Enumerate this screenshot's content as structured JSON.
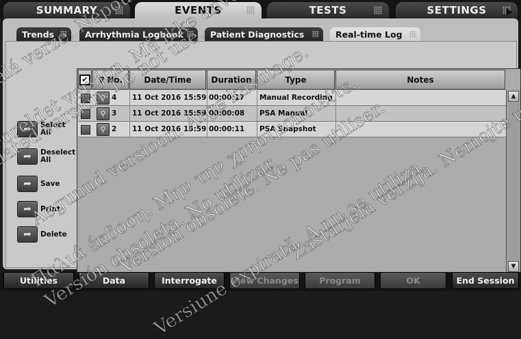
{
  "top_tabs": [
    {
      "label": "SUMMARY",
      "active": false
    },
    {
      "label": "EVENTS",
      "active": true
    },
    {
      "label": "TESTS",
      "active": false
    },
    {
      "label": "SETTINGS",
      "active": false
    }
  ],
  "sub_tabs": [
    {
      "label": "Trends",
      "active": false
    },
    {
      "label": "Arrhythmia Logbook",
      "active": false
    },
    {
      "label": "Patient Diagnostics",
      "active": false
    },
    {
      "label": "Real-time Log",
      "active": true
    }
  ],
  "side_actions": [
    {
      "label": "Select All",
      "icon": "select-arrow-icon"
    },
    {
      "label": "Deselect All",
      "icon": "deselect-arrow-icon"
    },
    {
      "label": "Save",
      "icon": "save-arrow-icon"
    },
    {
      "label": "Print",
      "icon": "print-arrow-icon"
    },
    {
      "label": "Delete",
      "icon": "delete-arrow-icon"
    }
  ],
  "table": {
    "sort_glyph": "∇",
    "columns": [
      "No.",
      "Date/Time",
      "Duration",
      "Type",
      "Notes"
    ],
    "rows": [
      {
        "no": "4",
        "datetime": "11 Oct 2016 15:59",
        "duration": "00:00:17",
        "type": "Manual Recording",
        "notes": ""
      },
      {
        "no": "3",
        "datetime": "11 Oct 2016 15:59",
        "duration": "00:00:08",
        "type": "PSA Manual",
        "notes": ""
      },
      {
        "no": "2",
        "datetime": "11 Oct 2016 15:59",
        "duration": "00:00:11",
        "type": "PSA Snapshot",
        "notes": ""
      }
    ]
  },
  "bottom_buttons": [
    {
      "label": "Utilities",
      "enabled": true
    },
    {
      "label": "Data",
      "enabled": true
    },
    {
      "label": "Interrogate",
      "enabled": true
    },
    {
      "label": "View Changes",
      "enabled": false
    },
    {
      "label": "Program",
      "enabled": false
    },
    {
      "label": "OK",
      "enabled": false
    },
    {
      "label": "End Session",
      "enabled": true
    }
  ],
  "watermark_lines": [
    "Outdated version. Do not use.",
    "Version obsolète. Ne pas utiliser.",
    "Versión obsoleta. No utilizar.",
    "Zastaralá verze. Nepoužívat.",
    "Aegunud versioon. Ärge kasutage.",
    "Παλιά έκδοση. Μην την χρησιμοποιείτε.",
    "Zastarjela verzija. Nemojte upotrebljavati.",
    "Foreldet versjon. Må ikke anvendes.",
    "Versiune expirată. A nu se utiliza."
  ],
  "colors": {
    "frame": "#141414",
    "panel": "#bdbdbd",
    "active_tab": "#cfcfcf"
  }
}
